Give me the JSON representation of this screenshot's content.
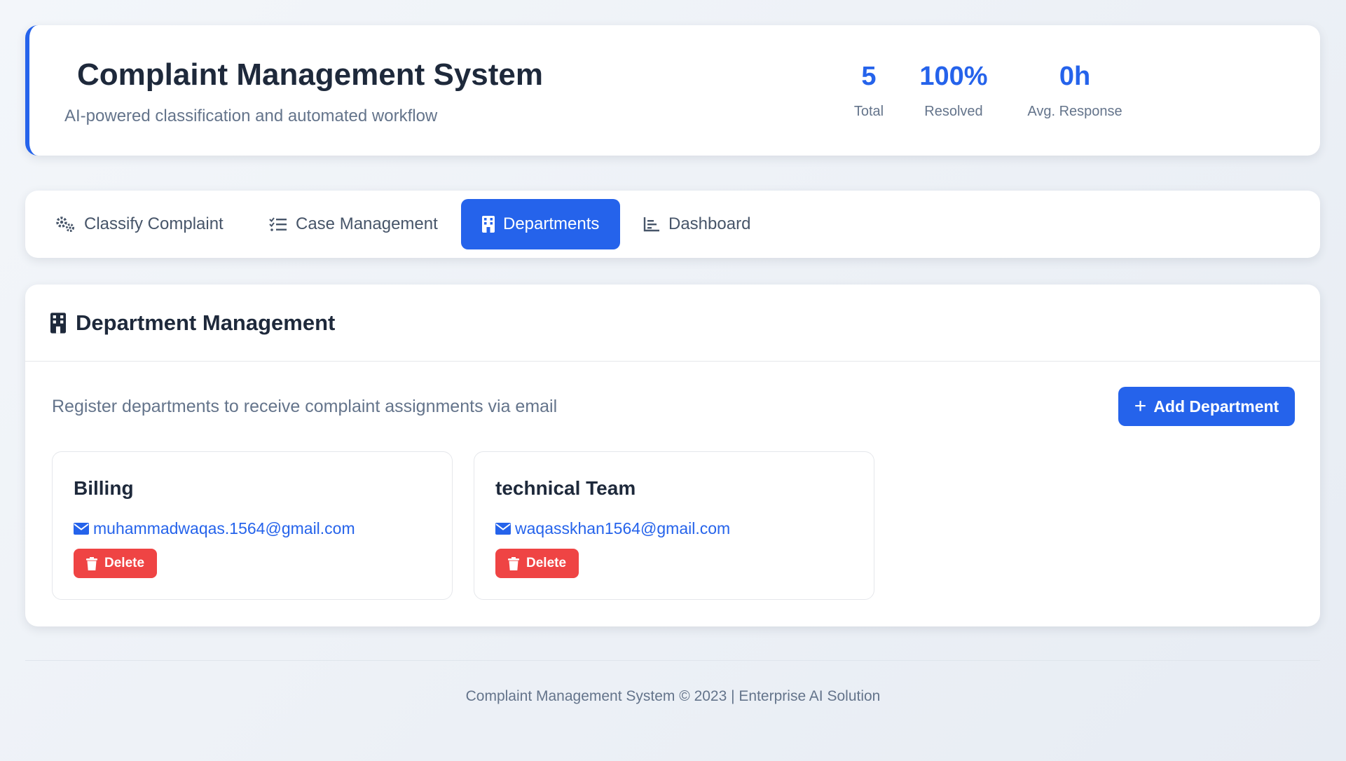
{
  "header": {
    "title": "Complaint Management System",
    "subtitle": "AI-powered classification and automated workflow",
    "accent_color": "#2563eb",
    "stats": [
      {
        "value": "5",
        "label": "Total"
      },
      {
        "value": "100%",
        "label": "Resolved"
      },
      {
        "value": "0h",
        "label": "Avg. Response"
      }
    ]
  },
  "tabs": [
    {
      "label": "Classify Complaint",
      "icon": "gears-icon",
      "active": false
    },
    {
      "label": "Case Management",
      "icon": "list-check-icon",
      "active": false
    },
    {
      "label": "Departments",
      "icon": "building-icon",
      "active": true
    },
    {
      "label": "Dashboard",
      "icon": "chart-icon",
      "active": false
    }
  ],
  "panel": {
    "title": "Department Management",
    "title_icon": "building-icon",
    "description": "Register departments to receive complaint assignments via email",
    "add_button_label": "Add Department",
    "add_button_icon": "plus-icon"
  },
  "departments": [
    {
      "name": "Billing",
      "email": "muhammadwaqas.1564@gmail.com",
      "delete_label": "Delete"
    },
    {
      "name": "technical Team",
      "email": "waqasskhan1564@gmail.com",
      "delete_label": "Delete"
    }
  ],
  "colors": {
    "primary": "#2563eb",
    "danger": "#ef4444",
    "muted_text": "#64748b",
    "heading_text": "#1e293b"
  },
  "footer": {
    "text": "Complaint Management System © 2023 | Enterprise AI Solution"
  }
}
